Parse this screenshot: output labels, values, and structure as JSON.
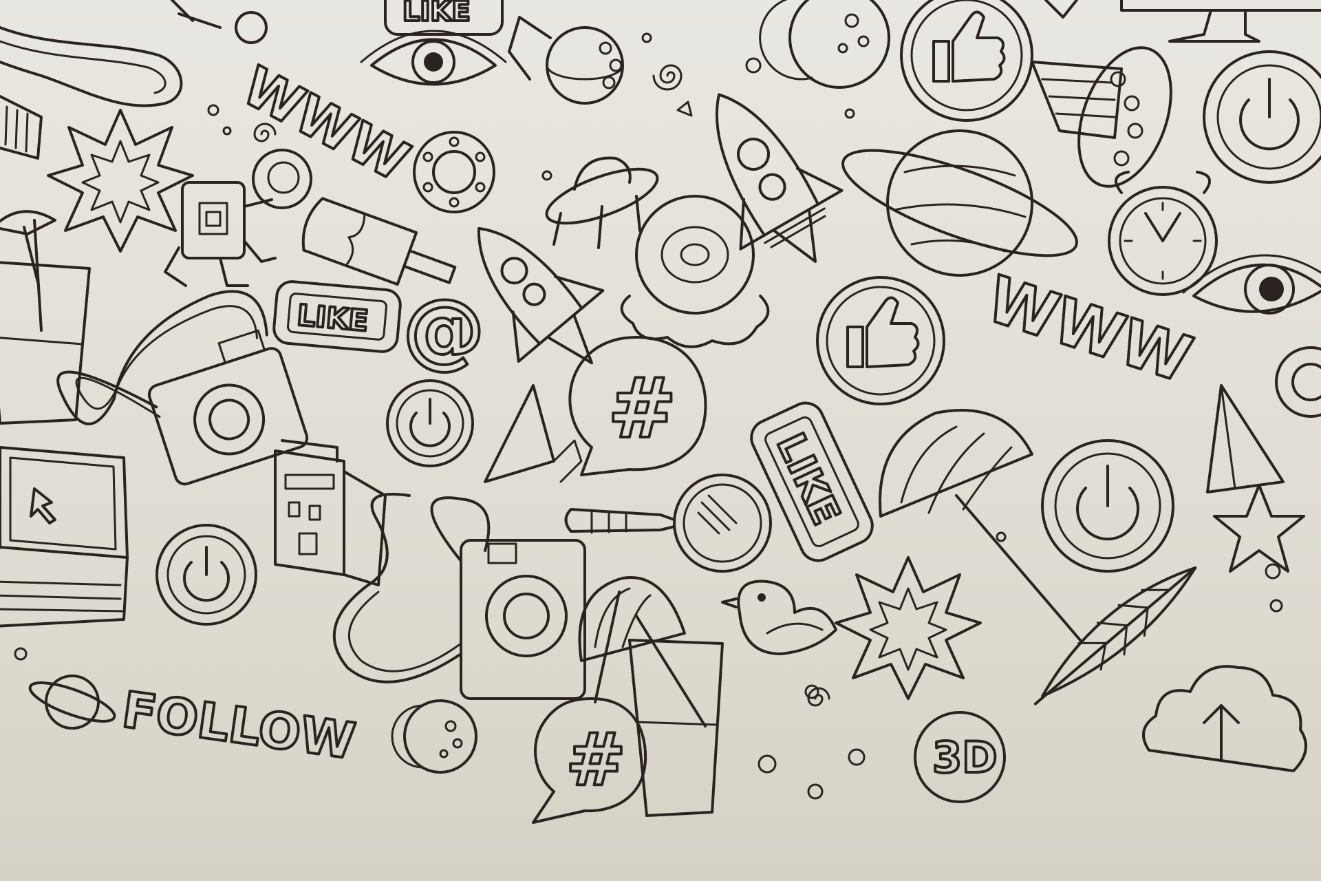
{
  "image": {
    "kind": "line-art doodle wall",
    "background_color": "#e4e1d9",
    "ink_color": "#2a2320"
  },
  "texts": {
    "www_1": "WWW",
    "www_2": "WWW",
    "like_1": "LIKE",
    "like_2": "LIKE",
    "like_3": "LIKE",
    "follow": "FOLLOW",
    "three_d": "3D",
    "at": "@",
    "hash_1": "#",
    "hash_2": "#"
  },
  "icons": [
    "saturn-planet-icon",
    "rocket-icon",
    "ufo-icon",
    "robot-astronaut-icon",
    "camera-icon",
    "laptop-icon",
    "power-button-icon",
    "thumbs-up-icon",
    "eye-icon",
    "alarm-clock-icon",
    "umbrella-icon",
    "drink-glass-icon",
    "magnifier-icon",
    "bird-icon",
    "feather-icon",
    "paper-plane-icon",
    "star-icon",
    "burst-icon",
    "cloud-upload-icon",
    "moon-icon",
    "building-icon",
    "ice-cream-icon",
    "cupcake-icon",
    "monitor-icon"
  ]
}
